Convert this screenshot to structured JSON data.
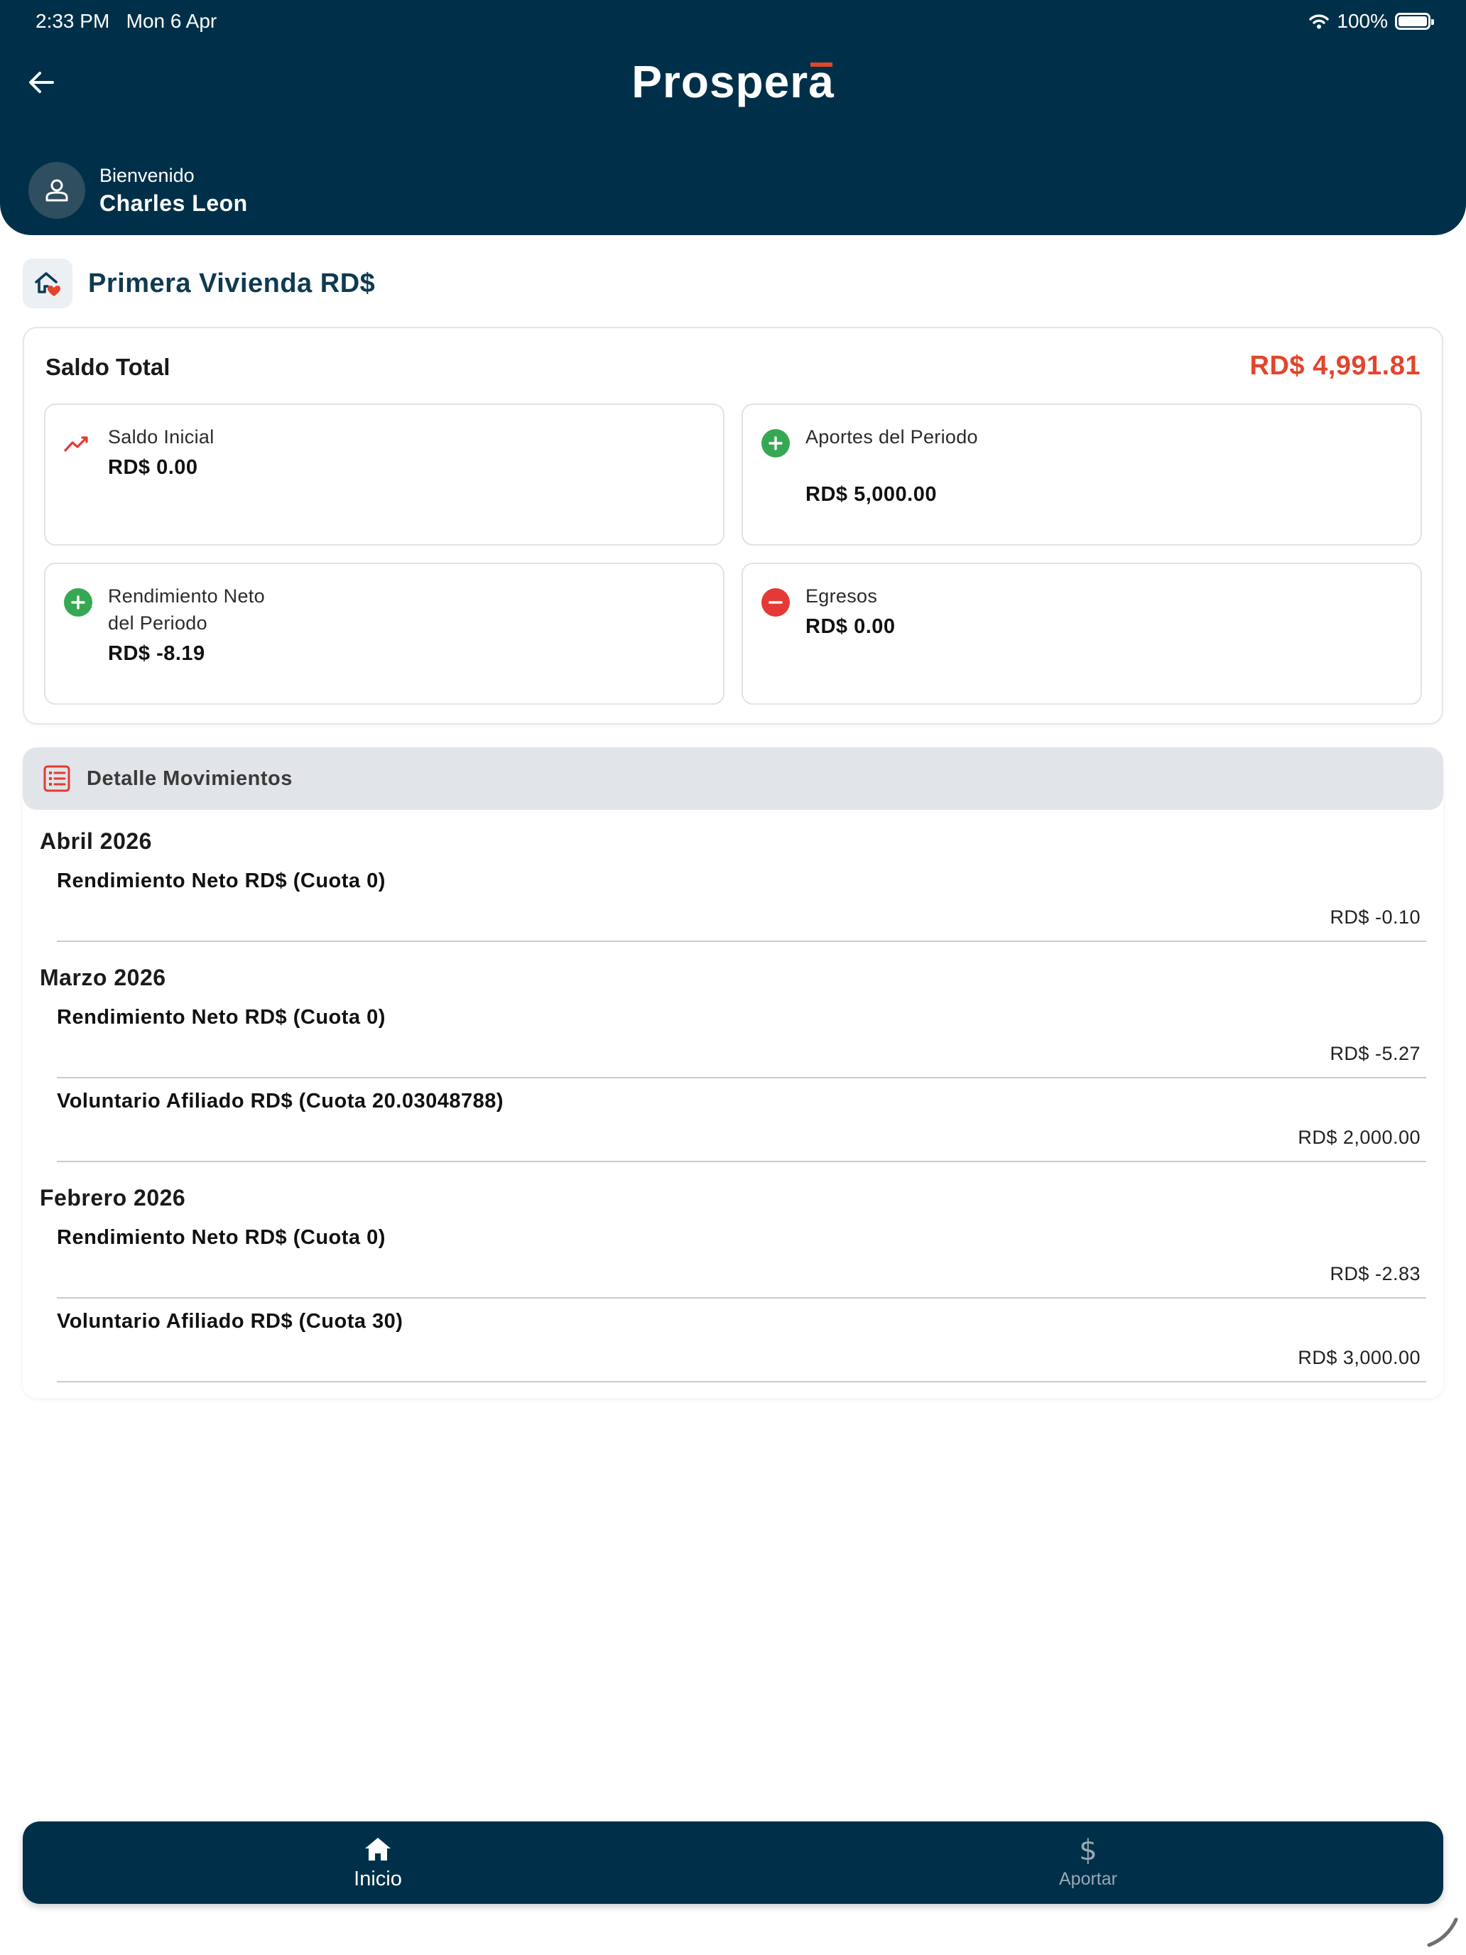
{
  "status_bar": {
    "time": "2:33 PM",
    "date": "Mon 6 Apr",
    "battery": "100%"
  },
  "header": {
    "logo_main": "Prosper",
    "logo_accent": "a",
    "welcome_label": "Bienvenido",
    "user_name": "Charles Leon"
  },
  "plan": {
    "title": "Primera Vivienda RD$"
  },
  "balance": {
    "label": "Saldo Total",
    "value": "RD$ 4,991.81",
    "stats": [
      {
        "label": "Saldo Inicial",
        "value": "RD$ 0.00",
        "icon": "trend-icon"
      },
      {
        "label": "Aportes del Periodo",
        "value": "RD$ 5,000.00",
        "icon": "plus-circle-icon"
      },
      {
        "label": "Rendimiento Neto del Periodo",
        "value": "RD$ -8.19",
        "icon": "plus-circle-icon"
      },
      {
        "label": "Egresos",
        "value": "RD$ 0.00",
        "icon": "minus-circle-icon"
      }
    ]
  },
  "detail": {
    "title": "Detalle Movimientos",
    "months": [
      {
        "name": "Abril 2026",
        "items": [
          {
            "title": "Rendimiento Neto RD$ (Cuota 0)",
            "amount": "RD$ -0.10"
          }
        ]
      },
      {
        "name": "Marzo 2026",
        "items": [
          {
            "title": "Rendimiento Neto RD$ (Cuota 0)",
            "amount": "RD$ -5.27"
          },
          {
            "title": "Voluntario Afiliado RD$ (Cuota 20.03048788)",
            "amount": "RD$ 2,000.00"
          }
        ]
      },
      {
        "name": "Febrero 2026",
        "items": [
          {
            "title": "Rendimiento Neto RD$ (Cuota 0)",
            "amount": "RD$ -2.83"
          },
          {
            "title": "Voluntario Afiliado RD$ (Cuota 30)",
            "amount": "RD$ 3,000.00"
          }
        ]
      }
    ]
  },
  "bottom_nav": {
    "items": [
      {
        "label": "Inicio",
        "icon": "home-icon",
        "active": true
      },
      {
        "label": "Aportar",
        "icon": "dollar-icon",
        "active": false
      }
    ]
  },
  "colors": {
    "primary": "#003049",
    "accent_red": "#e2452c",
    "green": "#36a853",
    "red": "#e53935"
  }
}
